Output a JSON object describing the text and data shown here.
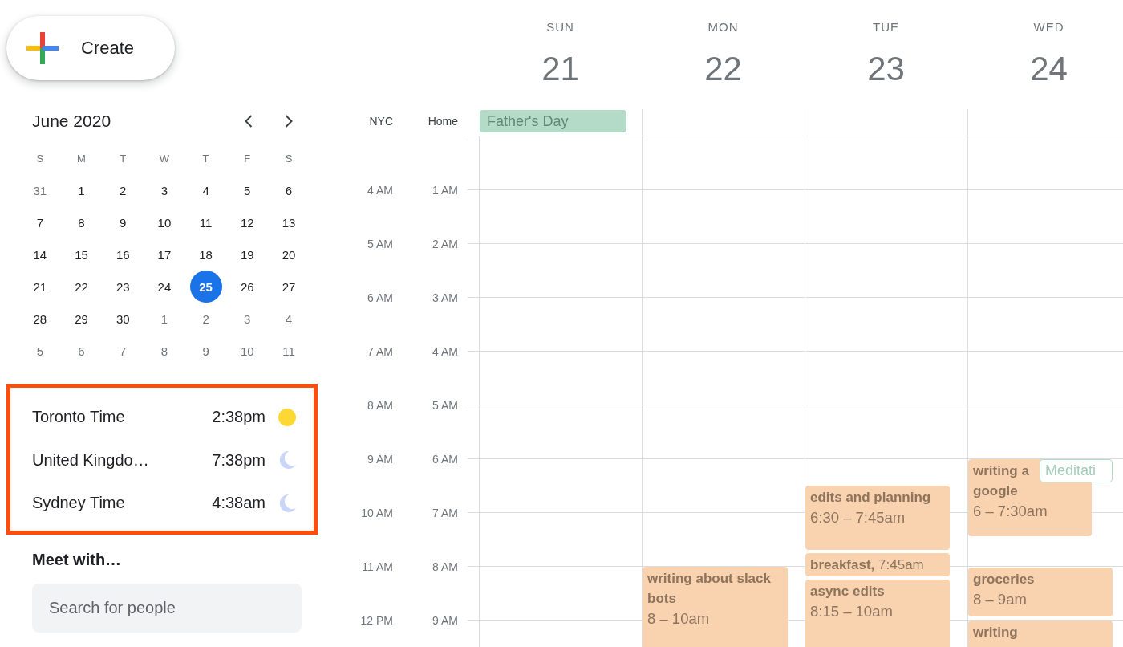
{
  "create_button": {
    "label": "Create"
  },
  "mini_calendar": {
    "title": "June 2020",
    "weekdays": [
      "S",
      "M",
      "T",
      "W",
      "T",
      "F",
      "S"
    ],
    "weeks": [
      [
        {
          "day": "31",
          "outside_month": true,
          "selected": false
        },
        {
          "day": "1",
          "outside_month": false,
          "selected": false
        },
        {
          "day": "2",
          "outside_month": false,
          "selected": false
        },
        {
          "day": "3",
          "outside_month": false,
          "selected": false
        },
        {
          "day": "4",
          "outside_month": false,
          "selected": false
        },
        {
          "day": "5",
          "outside_month": false,
          "selected": false
        },
        {
          "day": "6",
          "outside_month": false,
          "selected": false
        }
      ],
      [
        {
          "day": "7",
          "outside_month": false,
          "selected": false
        },
        {
          "day": "8",
          "outside_month": false,
          "selected": false
        },
        {
          "day": "9",
          "outside_month": false,
          "selected": false
        },
        {
          "day": "10",
          "outside_month": false,
          "selected": false
        },
        {
          "day": "11",
          "outside_month": false,
          "selected": false
        },
        {
          "day": "12",
          "outside_month": false,
          "selected": false
        },
        {
          "day": "13",
          "outside_month": false,
          "selected": false
        }
      ],
      [
        {
          "day": "14",
          "outside_month": false,
          "selected": false
        },
        {
          "day": "15",
          "outside_month": false,
          "selected": false
        },
        {
          "day": "16",
          "outside_month": false,
          "selected": false
        },
        {
          "day": "17",
          "outside_month": false,
          "selected": false
        },
        {
          "day": "18",
          "outside_month": false,
          "selected": false
        },
        {
          "day": "19",
          "outside_month": false,
          "selected": false
        },
        {
          "day": "20",
          "outside_month": false,
          "selected": false
        }
      ],
      [
        {
          "day": "21",
          "outside_month": false,
          "selected": false
        },
        {
          "day": "22",
          "outside_month": false,
          "selected": false
        },
        {
          "day": "23",
          "outside_month": false,
          "selected": false
        },
        {
          "day": "24",
          "outside_month": false,
          "selected": false
        },
        {
          "day": "25",
          "outside_month": false,
          "selected": true
        },
        {
          "day": "26",
          "outside_month": false,
          "selected": false
        },
        {
          "day": "27",
          "outside_month": false,
          "selected": false
        }
      ],
      [
        {
          "day": "28",
          "outside_month": false,
          "selected": false
        },
        {
          "day": "29",
          "outside_month": false,
          "selected": false
        },
        {
          "day": "30",
          "outside_month": false,
          "selected": false
        },
        {
          "day": "1",
          "outside_month": true,
          "selected": false
        },
        {
          "day": "2",
          "outside_month": true,
          "selected": false
        },
        {
          "day": "3",
          "outside_month": true,
          "selected": false
        },
        {
          "day": "4",
          "outside_month": true,
          "selected": false
        }
      ],
      [
        {
          "day": "5",
          "outside_month": true,
          "selected": false
        },
        {
          "day": "6",
          "outside_month": true,
          "selected": false
        },
        {
          "day": "7",
          "outside_month": true,
          "selected": false
        },
        {
          "day": "8",
          "outside_month": true,
          "selected": false
        },
        {
          "day": "9",
          "outside_month": true,
          "selected": false
        },
        {
          "day": "10",
          "outside_month": true,
          "selected": false
        },
        {
          "day": "11",
          "outside_month": true,
          "selected": false
        }
      ]
    ]
  },
  "world_clock": [
    {
      "city": "Toronto Time",
      "time": "2:38pm",
      "kind": "day"
    },
    {
      "city": "United Kingdo…",
      "time": "7:38pm",
      "kind": "night"
    },
    {
      "city": "Sydney Time",
      "time": "4:38am",
      "kind": "night"
    }
  ],
  "meet_with": {
    "heading": "Meet with…",
    "search": {
      "placeholder": "Search for people"
    }
  },
  "time_zones": [
    {
      "label": "NYC",
      "hours": [
        "4 AM",
        "5 AM",
        "6 AM",
        "7 AM",
        "8 AM",
        "9 AM",
        "10 AM",
        "11 AM",
        "12 PM"
      ]
    },
    {
      "label": "Home",
      "hours": [
        "1 AM",
        "2 AM",
        "3 AM",
        "4 AM",
        "5 AM",
        "6 AM",
        "7 AM",
        "8 AM",
        "9 AM"
      ]
    }
  ],
  "days": [
    {
      "name": "SUN",
      "date": "21",
      "all_day": [
        {
          "title": "Father's Day",
          "color": "#b3dbc8"
        }
      ]
    },
    {
      "name": "MON",
      "date": "22",
      "events": [
        {
          "kind": "block",
          "title": "writing about slack bots",
          "time": "8 – 10am",
          "color": "#f9d2b0"
        }
      ]
    },
    {
      "name": "TUE",
      "date": "23",
      "events": [
        {
          "kind": "block",
          "title": "edits and planning",
          "time": "6:30 – 7:45am",
          "color": "#f9d2b0"
        },
        {
          "kind": "inline",
          "text": "**breakfast,** 7:45am",
          "color": "#f9d2b0"
        },
        {
          "kind": "block",
          "title": "async edits",
          "time": "8:15 – 10am",
          "color": "#f9d2b0"
        }
      ]
    },
    {
      "name": "WED",
      "date": "24",
      "events": [
        {
          "kind": "block",
          "title": "writing a\ngoogle",
          "time": "6 – 7:30am",
          "color": "#f9d2b0"
        },
        {
          "kind": "outlined",
          "title": "Meditati",
          "color": "#b3dbc8"
        },
        {
          "kind": "block",
          "title": "groceries",
          "time": "8 – 9am",
          "color": "#f9d2b0"
        },
        {
          "kind": "block",
          "title": "writing",
          "color": "#f9d2b0"
        }
      ]
    }
  ]
}
